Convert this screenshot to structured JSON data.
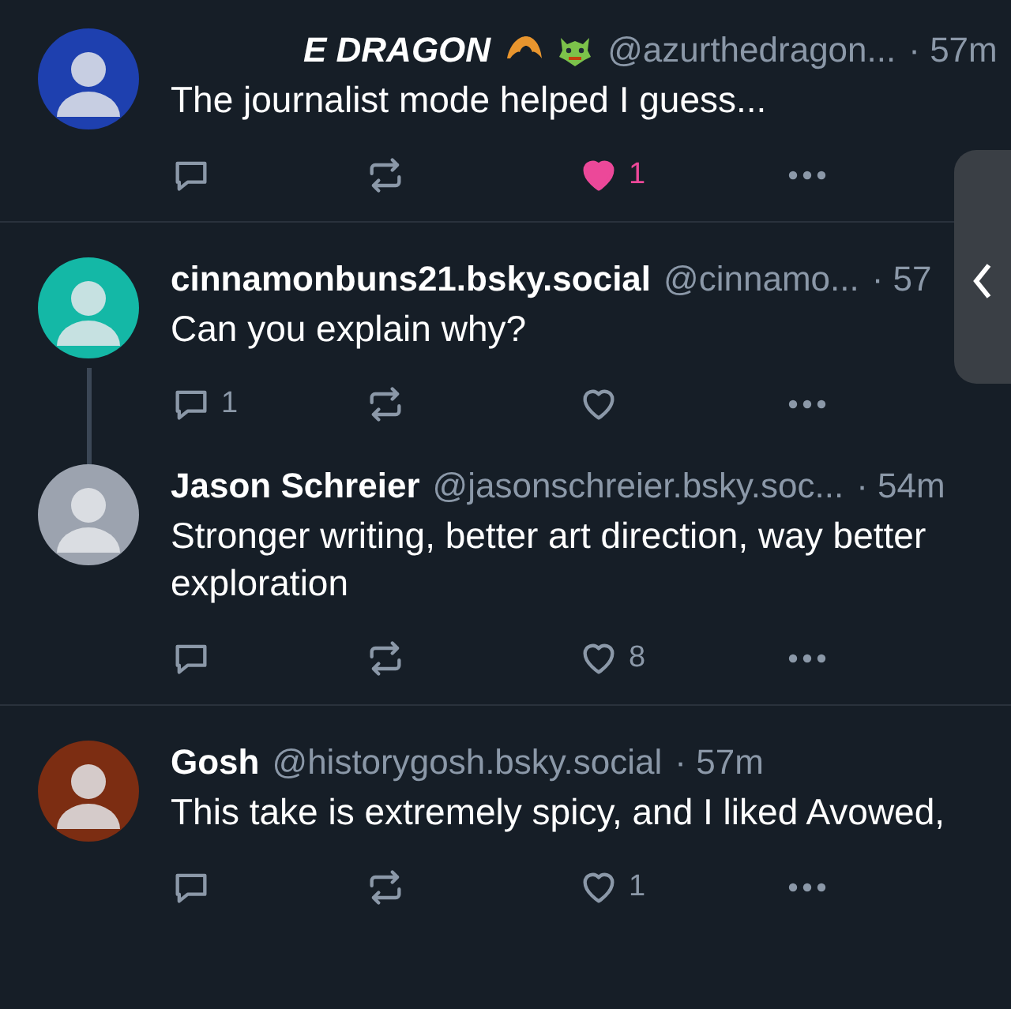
{
  "posts": [
    {
      "display_name": "E DRAGON",
      "italic": true,
      "handle": "@azurthedragon...",
      "time": "· 57m",
      "text": "The journalist mode helped I guess...",
      "thread_line": false,
      "divider": true,
      "likes": "1",
      "liked": true
    },
    {
      "display_name": "cinnamonbuns21.bsky.social",
      "italic": false,
      "handle": "@cinnamo...",
      "time": "· 57",
      "text": "Can you explain why?",
      "thread_line": true,
      "divider": false,
      "replies": "1",
      "liked": false
    },
    {
      "display_name": "Jason Schreier",
      "italic": false,
      "handle": "@jasonschreier.bsky.soc...",
      "time": "· 54m",
      "text": "Stronger writing, better art direction, way better exploration",
      "thread_line": false,
      "divider": true,
      "likes": "8",
      "liked": false
    },
    {
      "display_name": "Gosh",
      "italic": false,
      "handle": "@historygosh.bsky.social",
      "time": "· 57m",
      "text": "This take is extremely spicy, and I liked Avowed,",
      "thread_line": false,
      "divider": false,
      "likes": "1",
      "liked": false
    }
  ],
  "side_handle": {
    "expanded": false
  }
}
